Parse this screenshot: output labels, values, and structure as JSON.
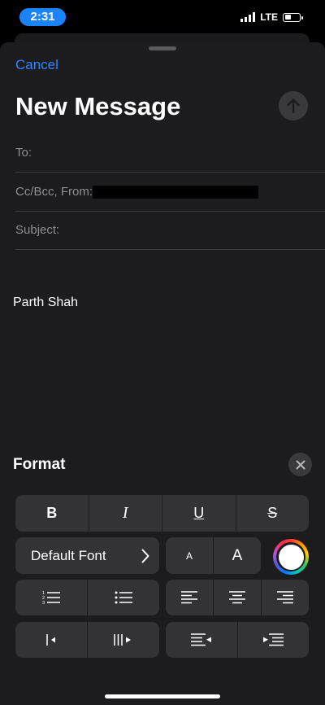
{
  "status_bar": {
    "time": "2:31",
    "network": "LTE",
    "battery_level": 0.45
  },
  "compose": {
    "cancel_label": "Cancel",
    "title": "New Message",
    "to_label": "To:",
    "cc_label": "Cc/Bcc, From:",
    "subject_label": "Subject:",
    "signature": "Parth Shah"
  },
  "format": {
    "title": "Format",
    "bold": "B",
    "italic": "I",
    "underline": "U",
    "strikethrough": "S",
    "font_name": "Default Font",
    "small_size": "A",
    "large_size": "A",
    "selected_color": "#ffffff"
  },
  "icons": [
    "send-arrow-icon",
    "close-icon",
    "chevron-right-icon",
    "numbered-list-icon",
    "bulleted-list-icon",
    "align-left-icon",
    "align-center-icon",
    "align-right-icon",
    "decrease-indent-icon",
    "increase-indent-icon",
    "outdent-quote-icon",
    "indent-quote-icon"
  ],
  "colors": {
    "accent": "#2f86ff",
    "sheet_background": "#1c1c1e",
    "button_background": "#333336"
  }
}
